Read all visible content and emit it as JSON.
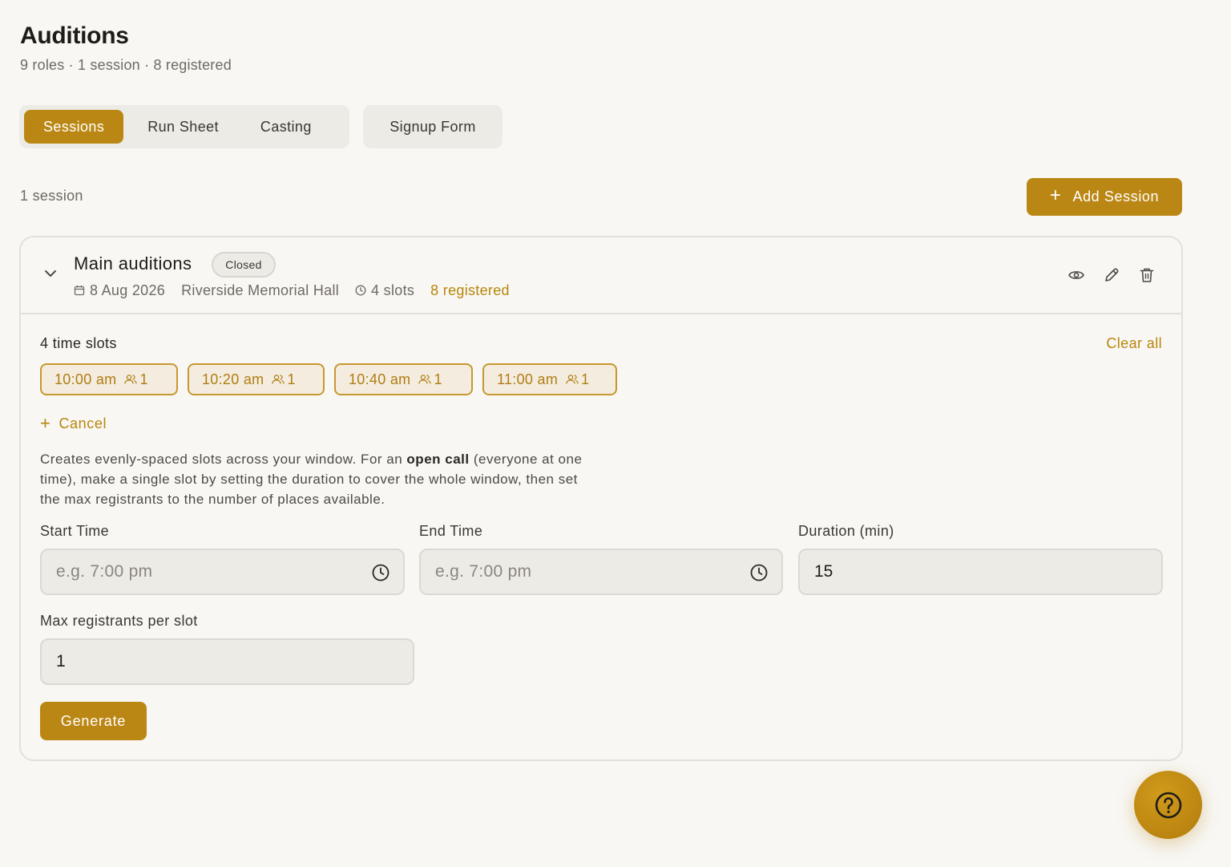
{
  "header": {
    "title": "Auditions",
    "subtitle": "9 roles · 1 session · 8 registered"
  },
  "tabs": [
    {
      "label": "Sessions",
      "active": true
    },
    {
      "label": "Run Sheet",
      "active": false
    },
    {
      "label": "Casting",
      "active": false
    }
  ],
  "signup_tab": {
    "label": "Signup Form"
  },
  "toolbar": {
    "session_count": "1 session",
    "add_session_label": "Add Session"
  },
  "session": {
    "name": "Main auditions",
    "status": "Closed",
    "date": "8 Aug 2026",
    "venue": "Riverside Memorial Hall",
    "slots": "4 slots",
    "registered": "8 registered",
    "actions": [
      "eye-icon",
      "pencil-icon",
      "trash-icon"
    ]
  },
  "timeslots": {
    "label": "4 time slots",
    "clear_all": "Clear all",
    "items": [
      {
        "time": "10:00 am",
        "count": "1"
      },
      {
        "time": "10:20 am",
        "count": "1"
      },
      {
        "time": "10:40 am",
        "count": "1"
      },
      {
        "time": "11:00 am",
        "count": "1"
      }
    ]
  },
  "generator": {
    "cancel_label": "Cancel",
    "help_pre": "Creates evenly-spaced slots across your window. For an ",
    "help_bold": "open call",
    "help_post": " (everyone at one time), make a single slot by setting the duration to cover the whole window, then set the max registrants to the number of places available.",
    "start_label": "Start Time",
    "start_placeholder": "e.g. 7:00 pm",
    "end_label": "End Time",
    "end_placeholder": "e.g. 7:00 pm",
    "duration_label": "Duration (min)",
    "duration_value": "15",
    "max_label": "Max registrants per slot",
    "max_value": "1",
    "generate_label": "Generate"
  },
  "colors": {
    "accent": "#bb8714",
    "accent_text": "#b8860b",
    "background": "#f8f7f4"
  }
}
